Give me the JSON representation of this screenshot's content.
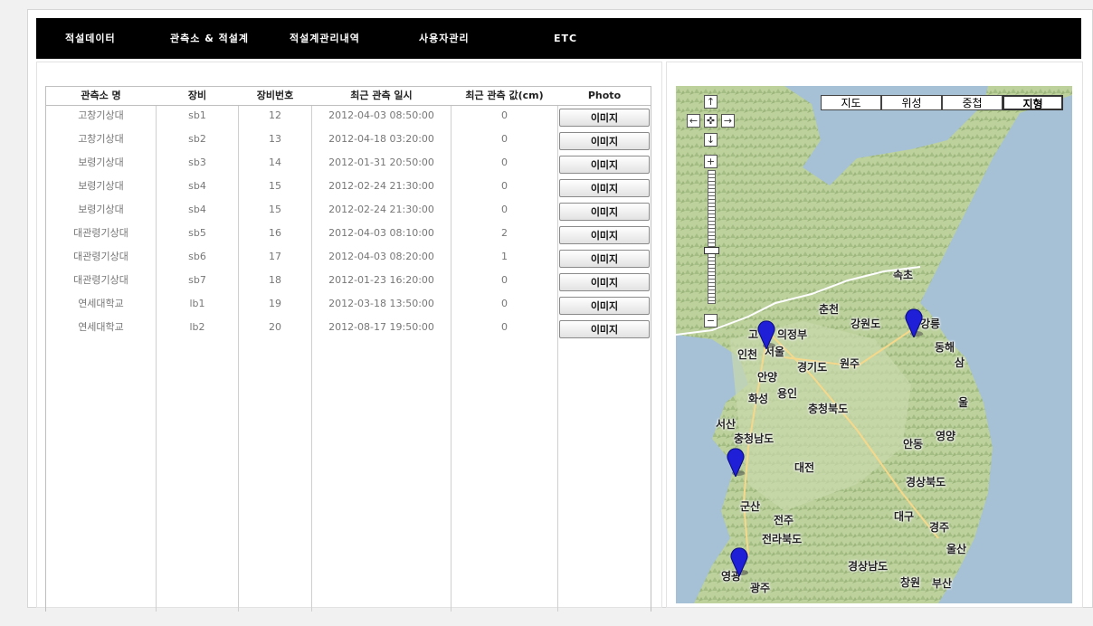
{
  "nav": [
    "적설데이터",
    "관측소 & 적설계",
    "적설계관리내역",
    "사용자관리",
    "ETC"
  ],
  "table": {
    "headers": [
      "관측소 명",
      "장비",
      "장비번호",
      "최근 관측 일시",
      "최근 관측 값(cm)",
      "Photo"
    ],
    "rows": [
      {
        "station": "고창기상대",
        "device": "sb1",
        "num": "12",
        "time": "2012-04-03 08:50:00",
        "value": "0",
        "photo": "이미지"
      },
      {
        "station": "고창기상대",
        "device": "sb2",
        "num": "13",
        "time": "2012-04-18 03:20:00",
        "value": "0",
        "photo": "이미지"
      },
      {
        "station": "보령기상대",
        "device": "sb3",
        "num": "14",
        "time": "2012-01-31 20:50:00",
        "value": "0",
        "photo": "이미지"
      },
      {
        "station": "보령기상대",
        "device": "sb4",
        "num": "15",
        "time": "2012-02-24 21:30:00",
        "value": "0",
        "photo": "이미지"
      },
      {
        "station": "보령기상대",
        "device": "sb4",
        "num": "15",
        "time": "2012-02-24 21:30:00",
        "value": "0",
        "photo": "이미지"
      },
      {
        "station": "대관령기상대",
        "device": "sb5",
        "num": "16",
        "time": "2012-04-03 08:10:00",
        "value": "2",
        "photo": "이미지"
      },
      {
        "station": "대관령기상대",
        "device": "sb6",
        "num": "17",
        "time": "2012-04-03 08:20:00",
        "value": "1",
        "photo": "이미지"
      },
      {
        "station": "대관령기상대",
        "device": "sb7",
        "num": "18",
        "time": "2012-01-23 16:20:00",
        "value": "0",
        "photo": "이미지"
      },
      {
        "station": "연세대학교",
        "device": "lb1",
        "num": "19",
        "time": "2012-03-18 13:50:00",
        "value": "0",
        "photo": "이미지"
      },
      {
        "station": "연세대학교",
        "device": "lb2",
        "num": "20",
        "time": "2012-08-17 19:50:00",
        "value": "0",
        "photo": "이미지"
      }
    ]
  },
  "map": {
    "types": [
      "지도",
      "위성",
      "중첩",
      "지형"
    ],
    "active_type": "지형",
    "controls": {
      "up": "↑",
      "left": "←",
      "center": "✜",
      "right": "→",
      "down": "↓",
      "zoom_in": "+",
      "zoom_out": "−"
    },
    "cities": [
      "속초",
      "춘천",
      "강원도",
      "강릉",
      "의정부",
      "고",
      "서울",
      "인천",
      "동해",
      "삼",
      "경기도",
      "원주",
      "안양",
      "용인",
      "화성",
      "충청북도",
      "울",
      "서산",
      "충청남도",
      "안동",
      "영양",
      "대전",
      "경상북도",
      "군산",
      "대구",
      "경주",
      "전주",
      "전라북도",
      "울산",
      "경상남도",
      "영광",
      "창원",
      "부산",
      "광주"
    ],
    "pin_count": 4,
    "colors": {
      "sea": "#a6c1d6",
      "land": "#c4d6a4",
      "mountain": "#9cb67c",
      "pin": "#1f1fd8"
    }
  }
}
